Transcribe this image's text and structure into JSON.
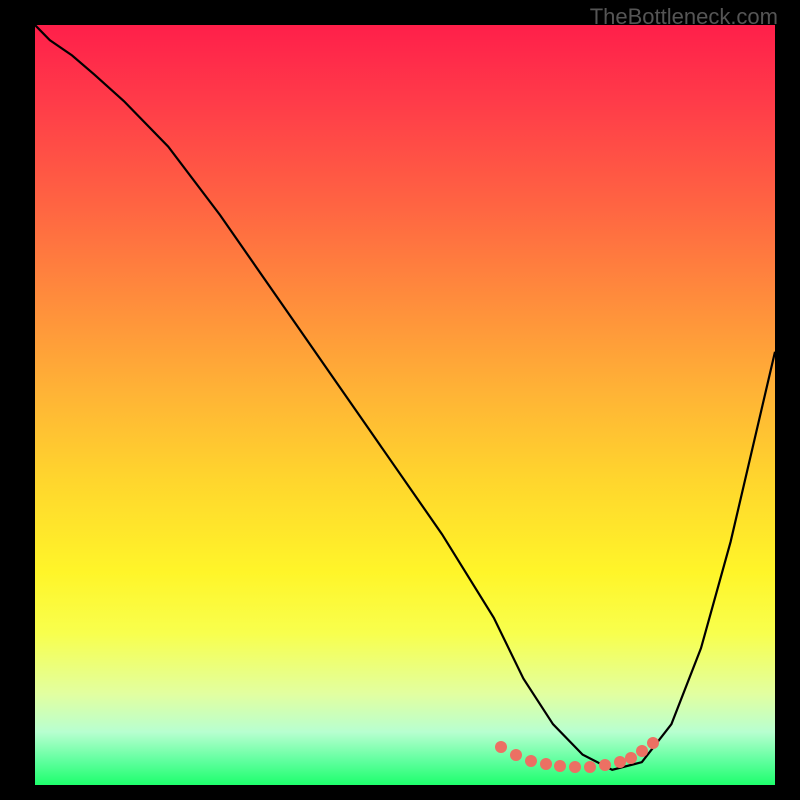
{
  "watermark": "TheBottleneck.com",
  "chart_data": {
    "type": "line",
    "title": "",
    "xlabel": "",
    "ylabel": "",
    "xlim": [
      0,
      100
    ],
    "ylim": [
      0,
      100
    ],
    "series": [
      {
        "name": "curve",
        "x": [
          0,
          2,
          5,
          8,
          12,
          18,
          25,
          35,
          45,
          55,
          62,
          66,
          70,
          74,
          78,
          82,
          86,
          90,
          94,
          100
        ],
        "y": [
          100,
          98,
          96,
          93.5,
          90,
          84,
          75,
          61,
          47,
          33,
          22,
          14,
          8,
          4,
          2,
          3,
          8,
          18,
          32,
          57
        ]
      }
    ],
    "markers": {
      "x": [
        63,
        65,
        67,
        69,
        71,
        73,
        75,
        77,
        79,
        80.5,
        82,
        83.5
      ],
      "y": [
        5,
        4,
        3.2,
        2.8,
        2.5,
        2.4,
        2.4,
        2.6,
        3.0,
        3.6,
        4.5,
        5.5
      ]
    },
    "gradient": "red-to-green vertical"
  }
}
